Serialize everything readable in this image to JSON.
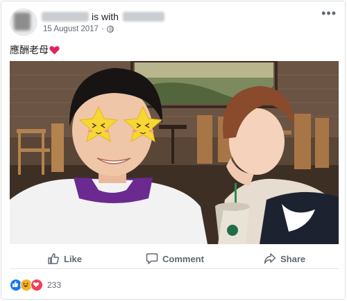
{
  "post": {
    "with_text": "is with",
    "date": "15 August 2017",
    "date_separator": "·",
    "caption": "應酬老母"
  },
  "actions": {
    "like_label": "Like",
    "comment_label": "Comment",
    "share_label": "Share"
  },
  "reactions": {
    "count": "233",
    "types": [
      "like-icon",
      "haha-icon",
      "love-icon"
    ]
  },
  "colors": {
    "accent": "#1877f2",
    "heart": "#e0245e",
    "text_secondary": "#606770",
    "blur": "#c9ccd1"
  }
}
